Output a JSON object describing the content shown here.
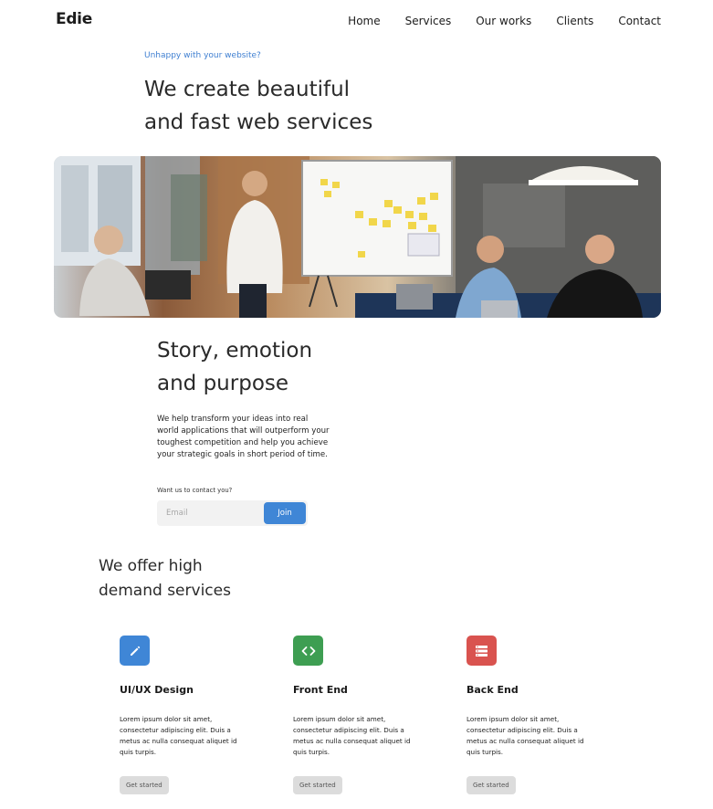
{
  "brand": {
    "logo": "Edie"
  },
  "nav": {
    "items": [
      "Home",
      "Services",
      "Our works",
      "Clients",
      "Contact"
    ]
  },
  "hero": {
    "eyebrow": "Unhappy with your website?",
    "title_line1": "We create beautiful",
    "title_line2": "and fast web services"
  },
  "story": {
    "title_line1": "Story, emotion",
    "title_line2": "and purpose",
    "text": "We help transform your ideas into real world applications that will outperform your toughest competition and help you achieve your strategic goals in short period of time.",
    "contact_label": "Want us to contact you?",
    "email_placeholder": "Email",
    "join_label": "Join"
  },
  "services": {
    "title_line1": "We offer high",
    "title_line2": "demand services",
    "cards": [
      {
        "icon": "pencil-icon",
        "color": "#3f86d6",
        "title": "UI/UX Design",
        "text": "Lorem ipsum dolor sit amet, consectetur adipiscing elit. Duis a metus ac nulla consequat aliquet id quis turpis.",
        "button": "Get started"
      },
      {
        "icon": "code-icon",
        "color": "#3e9e52",
        "title": "Front End",
        "text": "Lorem ipsum dolor sit amet, consectetur adipiscing elit. Duis a metus ac nulla consequat aliquet id quis turpis.",
        "button": "Get started"
      },
      {
        "icon": "server-icon",
        "color": "#d9534f",
        "title": "Back End",
        "text": "Lorem ipsum dolor sit amet, consectetur adipiscing elit. Duis a metus ac nulla consequat aliquet id quis turpis.",
        "button": "Get started"
      }
    ]
  }
}
